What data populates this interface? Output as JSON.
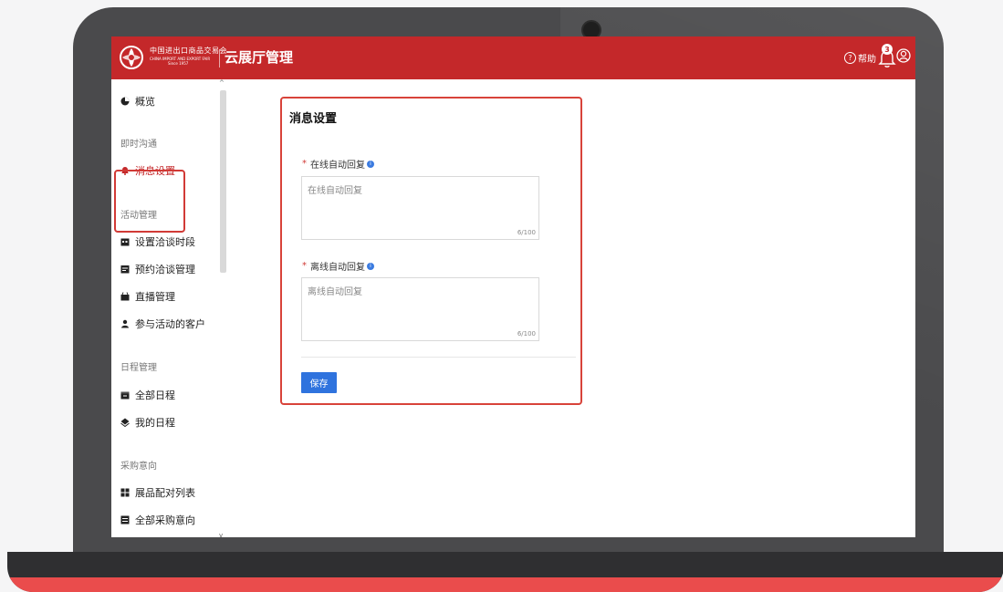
{
  "header": {
    "brand_cn": "中国进出口商品交易会",
    "brand_en": "CHINA IMPORT AND EXPORT FAIR",
    "brand_since": "Since 1957",
    "title": "云展厅管理",
    "help_label": "帮助",
    "notification_count": "3"
  },
  "sidebar": {
    "overview": "概览",
    "groups": {
      "im": "即时沟通",
      "activity": "活动管理",
      "schedule": "日程管理",
      "purchase": "采购意向"
    },
    "items": {
      "message_settings": "消息设置",
      "set_negotiation_time": "设置洽谈时段",
      "booking_management": "预约洽谈管理",
      "live_management": "直播管理",
      "activity_customers": "参与活动的客户",
      "all_schedule": "全部日程",
      "my_schedule": "我的日程",
      "product_match_list": "展品配对列表",
      "all_purchase_intent": "全部采购意向"
    }
  },
  "main": {
    "title": "消息设置",
    "online_label": "在线自动回复",
    "online_placeholder": "在线自动回复",
    "online_count": "6/100",
    "offline_label": "离线自动回复",
    "offline_placeholder": "离线自动回复",
    "offline_count": "6/100",
    "save_label": "保存"
  },
  "colors": {
    "header_bg": "#c4282a",
    "highlight": "#d13a36",
    "primary_button": "#2f73de",
    "info_icon": "#3b7be0"
  },
  "icons": {
    "overview": "pie-chart-icon",
    "message_settings": "bell-icon",
    "set_negotiation_time": "calendar-clock-icon",
    "booking_management": "calendar-list-icon",
    "live_management": "live-camera-icon",
    "activity_customers": "person-icon",
    "all_schedule": "calendar-icon",
    "my_schedule": "user-calendar-icon",
    "product_match_list": "match-grid-icon",
    "all_purchase_intent": "list-document-icon"
  }
}
